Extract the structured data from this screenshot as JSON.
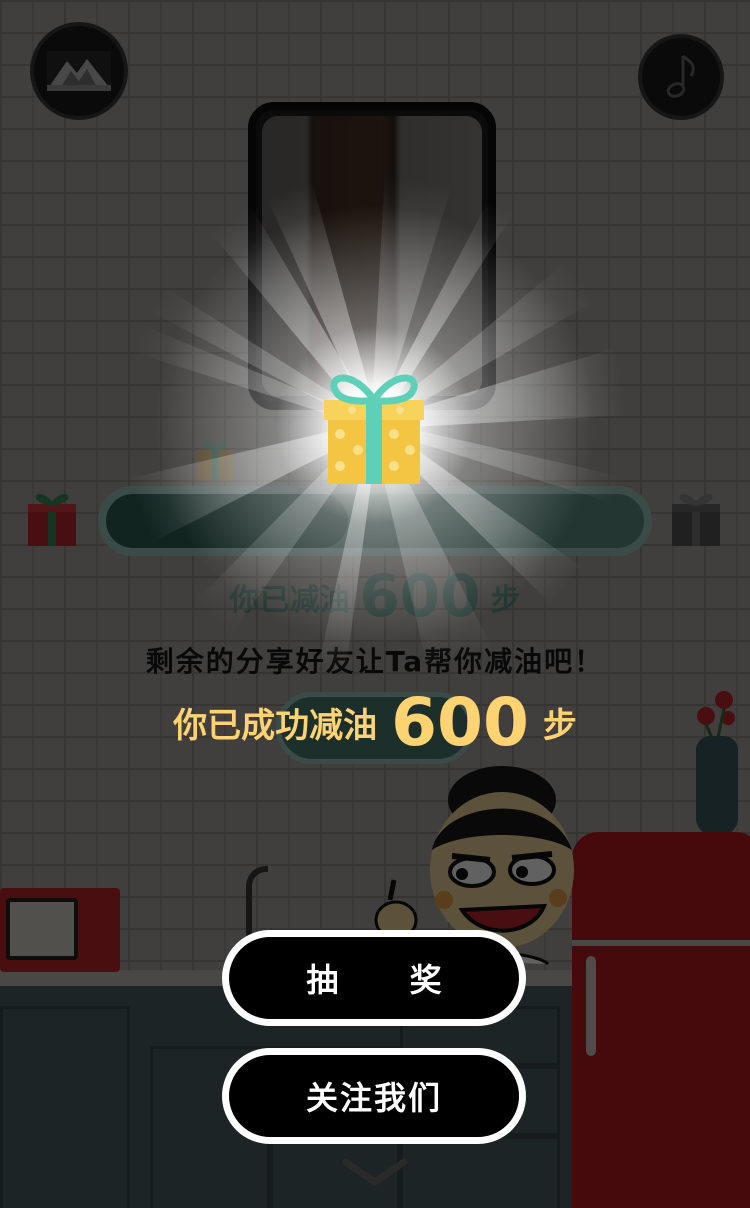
{
  "progress": {
    "reduced_prefix": "你已减油",
    "reduced_value": "600",
    "reduced_unit": "步",
    "fill_fraction": 0.45
  },
  "share_tip": "剩余的分享好友让Ta帮你减油吧！",
  "popup": {
    "success_prefix": "你已成功减油",
    "success_value": "600",
    "success_unit": "步",
    "draw_label": "抽 奖",
    "follow_label": "关注我们"
  },
  "icons": {
    "logo": "mountain-logo-icon",
    "music": "music-note-icon",
    "gift": "gift-box-icon",
    "scroll": "chevron-down-icon"
  },
  "colors": {
    "accent_gold": "#ffd372",
    "teal": "#5e8e80",
    "button_bg": "#000000",
    "button_border": "#ffffff"
  }
}
